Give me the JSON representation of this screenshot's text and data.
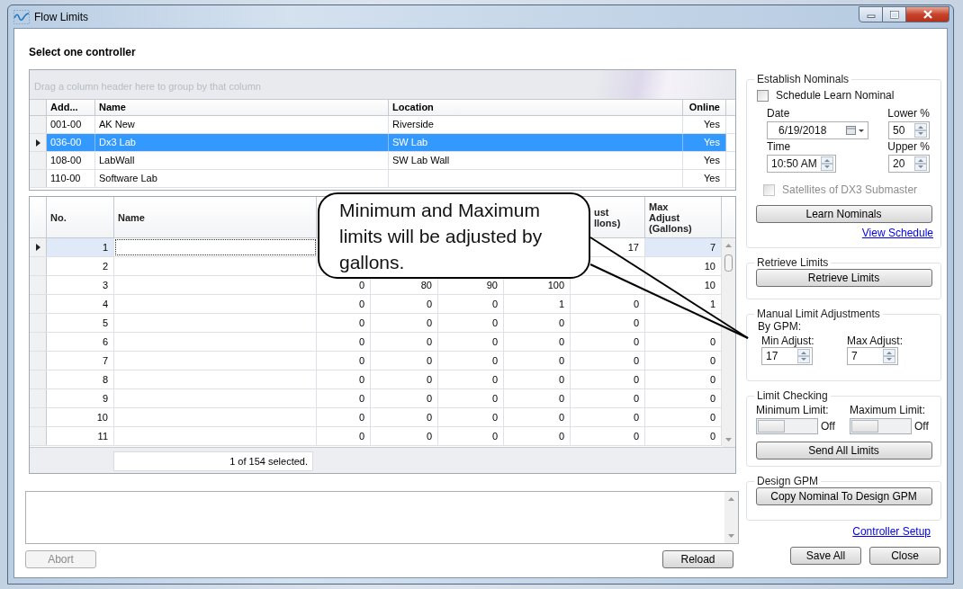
{
  "window": {
    "title": "Flow Limits"
  },
  "heading": "Select one controller",
  "controllers": {
    "group_hint": "Drag a column header here to group by that column",
    "columns": [
      "Add...",
      "Name",
      "Location",
      "Online"
    ],
    "rows": [
      {
        "cells": [
          "001-00",
          "AK New",
          "Riverside",
          "Yes"
        ],
        "selected": false
      },
      {
        "cells": [
          "036-00",
          "Dx3 Lab",
          "SW Lab",
          "Yes"
        ],
        "selected": true
      },
      {
        "cells": [
          "108-00",
          "LabWall",
          "SW Lab Wall",
          "Yes"
        ],
        "selected": false
      },
      {
        "cells": [
          "110-00",
          "Software Lab",
          null,
          "Yes"
        ],
        "selected": false
      }
    ]
  },
  "limits": {
    "columns": [
      {
        "lines": [
          "No."
        ]
      },
      {
        "lines": [
          "Name"
        ]
      },
      null,
      null,
      null,
      null,
      {
        "lines": [
          "ust",
          "llons)"
        ]
      },
      {
        "lines": [
          "Max",
          "Adjust",
          "(Gallons)"
        ]
      }
    ],
    "rows": [
      {
        "cells": [
          "1",
          null,
          null,
          null,
          null,
          null,
          "17",
          "7"
        ],
        "current": true
      },
      {
        "cells": [
          "2",
          null,
          null,
          null,
          null,
          null,
          null,
          "10"
        ],
        "current": false
      },
      {
        "cells": [
          "3",
          null,
          "0",
          "80",
          "90",
          "100",
          null,
          "10"
        ],
        "current": false
      },
      {
        "cells": [
          "4",
          null,
          "0",
          "0",
          "0",
          "1",
          "0",
          "1"
        ],
        "current": false
      },
      {
        "cells": [
          "5",
          null,
          "0",
          "0",
          "0",
          "0",
          "0",
          null
        ],
        "current": false
      },
      {
        "cells": [
          "6",
          null,
          "0",
          "0",
          "0",
          "0",
          "0",
          "0"
        ],
        "current": false
      },
      {
        "cells": [
          "7",
          null,
          "0",
          "0",
          "0",
          "0",
          "0",
          "0"
        ],
        "current": false
      },
      {
        "cells": [
          "8",
          null,
          "0",
          "0",
          "0",
          "0",
          "0",
          "0"
        ],
        "current": false
      },
      {
        "cells": [
          "9",
          null,
          "0",
          "0",
          "0",
          "0",
          "0",
          "0"
        ],
        "current": false
      },
      {
        "cells": [
          "10",
          null,
          "0",
          "0",
          "0",
          "0",
          "0",
          "0"
        ],
        "current": false
      },
      {
        "cells": [
          "11",
          null,
          "0",
          "0",
          "0",
          "0",
          "0",
          "0"
        ],
        "current": false
      }
    ],
    "status": "1 of 154 selected."
  },
  "bottom_buttons": [
    {
      "label": "Abort",
      "disabled": true
    },
    {
      "label": "Reload",
      "disabled": false
    }
  ],
  "side": {
    "establish": {
      "title": "Establish Nominals",
      "schedule": {
        "label": "Schedule Learn Nominal",
        "checked": false,
        "disabled": false
      },
      "date_label": "Date",
      "date": "6/19/2018",
      "lower_label": "Lower %",
      "lower": "50",
      "time_label": "Time",
      "time": "10:50 AM",
      "upper_label": "Upper %",
      "upper": "20",
      "satellites": {
        "label": "Satellites of DX3 Submaster",
        "checked": false,
        "disabled": true
      },
      "button": "Learn Nominals",
      "link": "View Schedule"
    },
    "retrieve": {
      "title": "Retrieve Limits",
      "button": "Retrieve Limits"
    },
    "manual": {
      "title": "Manual Limit Adjustments",
      "subtitle": "By GPM:",
      "min_label": "Min Adjust:",
      "min": "17",
      "max_label": "Max Adjust:",
      "max": "7"
    },
    "checking": {
      "title": "Limit Checking",
      "toggles": [
        {
          "label": "Minimum Limit:",
          "on": false,
          "state_text": "Off"
        },
        {
          "label": "Maximum Limit:",
          "on": false,
          "state_text": "Off"
        }
      ],
      "button": "Send All Limits"
    },
    "design": {
      "title": "Design GPM",
      "button": "Copy Nominal To Design GPM"
    },
    "link": "Controller Setup",
    "buttons": [
      "Save All",
      "Close"
    ]
  },
  "callout": {
    "text": "Minimum and Maximum limits will be adjusted by gallons."
  }
}
